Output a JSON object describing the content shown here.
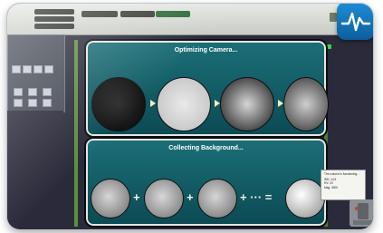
{
  "toolbar": {
    "row_buttons": [
      "",
      "",
      ""
    ],
    "dropdown_a": "",
    "dropdown_b": "",
    "dropdown_c": ""
  },
  "tree": {
    "root": "",
    "child_1": "",
    "child_2": ""
  },
  "panels": {
    "top_title": "Optimizing Camera...",
    "bottom_title": "Collecting Background..."
  },
  "bottom_ops": {
    "plus": "+",
    "ellipsis": "+ ··· =",
    "equals": "="
  },
  "tooltip": {
    "line1": "The column is functioning...",
    "line2": "WD: 14.5",
    "line3": "HV: 20",
    "line4": "Mag: 3000"
  },
  "colors": {
    "accent": "#1e8ed6",
    "panel_bg": "#1b6f78",
    "status_green": "#3fd14a"
  }
}
